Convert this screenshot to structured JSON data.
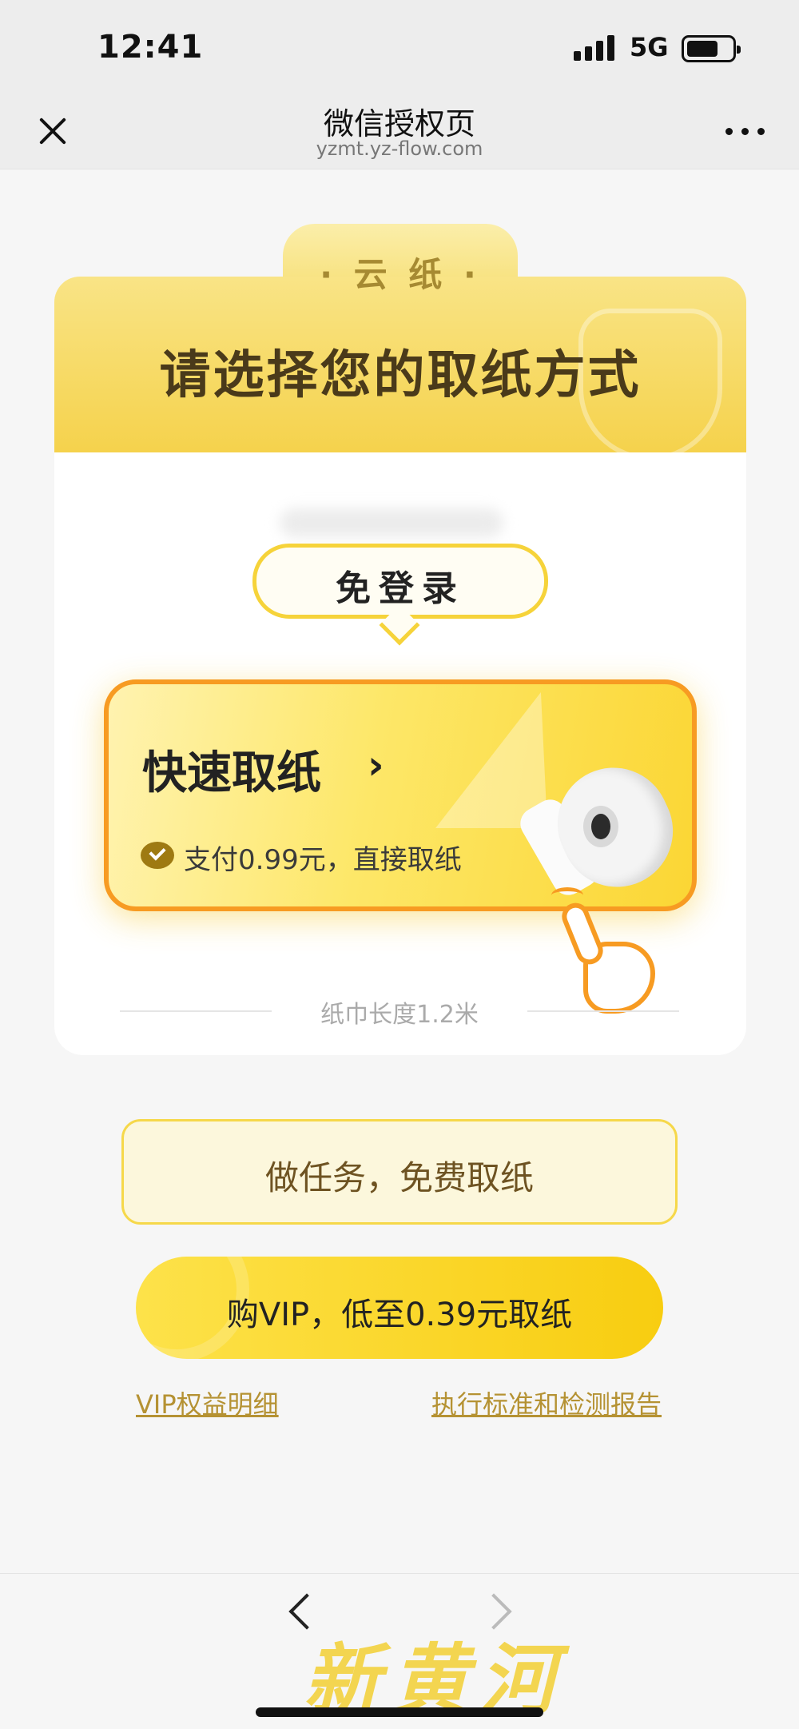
{
  "status_bar": {
    "time": "12:41",
    "network": "5G"
  },
  "nav": {
    "title": "微信授权页",
    "subtitle": "yzmt.yz-flow.com"
  },
  "header": {
    "tab_label": "· 云 纸 ·",
    "title": "请选择您的取纸方式"
  },
  "card": {
    "badge": "免登录",
    "quick": {
      "title": "快速取纸",
      "chevron": "›",
      "subtitle": "支付0.99元，直接取纸"
    },
    "length_note": "纸巾长度1.2米"
  },
  "buttons": {
    "task": "做任务，免费取纸",
    "vip": "购VIP，低至0.39元取纸"
  },
  "links": {
    "vip_details": "VIP权益明细",
    "report": "执行标准和检测报告"
  },
  "watermark": "新黄河",
  "colors": {
    "accent_yellow": "#fbd634",
    "accent_orange": "#f79b22",
    "link": "#b59233"
  }
}
